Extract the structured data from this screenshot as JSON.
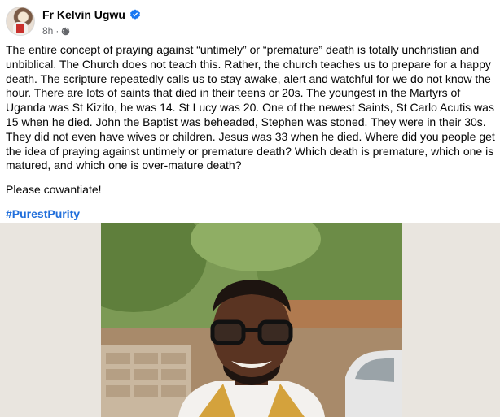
{
  "post": {
    "author": "Fr Kelvin Ugwu",
    "time": "8h",
    "separator": "·",
    "paragraphs": [
      "The entire concept of praying against “untimely” or “premature” death is totally unchristian and unbiblical. The Church does not teach this. Rather, the church teaches us to prepare for a happy death. The scripture repeatedly calls us to stay awake, alert and watchful for we do not know the hour. There are lots of saints that died in their teens or 20s. The youngest in the Martyrs of Uganda was St Kizito, he was 14. St Lucy was 20. One of the newest Saints, St Carlo Acutis was 15 when he died. John the Baptist was beheaded, Stephen was stoned. They were in their 30s. They did not even have wives or children. Jesus was 33 when he died. Where did you people get the idea of praying against untimely or premature death? Which death is premature, which one is matured, and which one is over-mature death?",
      "Please cowantiate!"
    ],
    "hashtag": "#PurestPurity"
  },
  "icons": {
    "verified": "verified-badge-icon",
    "audience": "globe-icon"
  },
  "colors": {
    "link": "#216fdb",
    "verified": "#1877f2",
    "secondary_text": "#65676b"
  }
}
